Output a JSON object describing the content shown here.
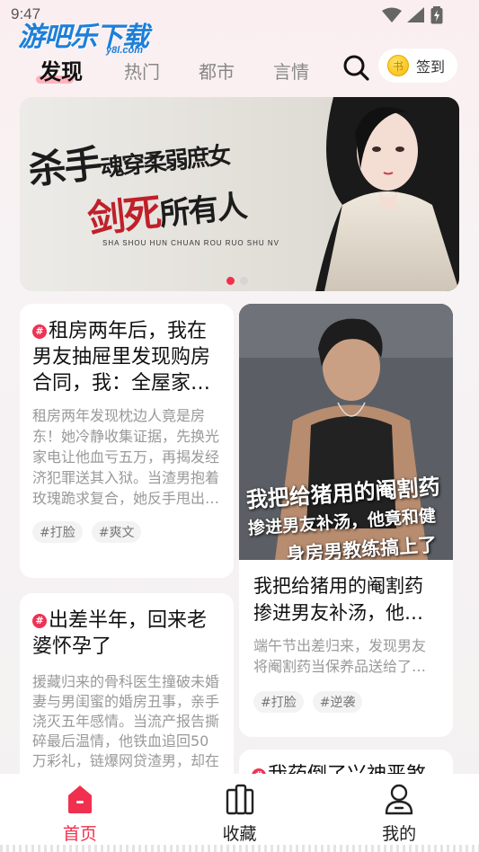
{
  "status": {
    "time": "9:47"
  },
  "watermark": {
    "main": "游吧乐下载",
    "sub": "y8l.com"
  },
  "tabs": [
    {
      "label": "发现",
      "active": true
    },
    {
      "label": "热门",
      "active": false
    },
    {
      "label": "都市",
      "active": false
    },
    {
      "label": "言情",
      "active": false
    }
  ],
  "header": {
    "signin_label": "签到",
    "coin_glyph": "书"
  },
  "banner": {
    "title_a": "杀手",
    "title_b": "魂穿柔弱庶女",
    "title_c": "剑死",
    "title_d": "所有人",
    "subtitle": "SHA SHOU   HUN CHUAN ROU RUO SHU NV",
    "page_total": 2,
    "page_current": 1
  },
  "cards": [
    {
      "hash": "#",
      "title": "租房两年后，我在男友抽屉里发现购房合同，我：全屋家具都是我买的",
      "desc": "租房两年发现枕边人竟是房东！她冷静收集证据，先换光家电让他血亏五万，再揭发经济犯罪送其入狱。当渣男抱着玫瑰跪求复合，她反手甩出转账记录。",
      "tags": [
        "#打脸",
        "#爽文"
      ]
    },
    {
      "cover_text_1": "我把给猪用的阉割药",
      "cover_text_2": "掺进男友补汤，他竟和健",
      "cover_text_3": "身房男教练搞上了",
      "title": "我把给猪用的阉割药掺进男友补汤，他竟和健身房男教练搞上了",
      "desc": "端午节出差归来，发现男友将阉割药当保养品送给了健身房教练。",
      "tags": [
        "#打脸",
        "#逆袭"
      ]
    },
    {
      "hash": "#",
      "title": "出差半年，回来老婆怀孕了",
      "desc": "援藏归来的骨科医生撞破未婚妻与男闺蜜的婚房丑事，亲手浇灭五年感情。当流产报告撕碎最后温情，他铁血追回50万彩礼，链爆网贷渣男，却在"
    },
    {
      "hash": "#",
      "title": "我药倒了兴神恶煞"
    }
  ],
  "bottom_nav": [
    {
      "label": "首页",
      "active": true
    },
    {
      "label": "收藏",
      "active": false
    },
    {
      "label": "我的",
      "active": false
    }
  ],
  "colors": {
    "accent": "#f0304e",
    "tag_bg": "#f3f3f3"
  }
}
